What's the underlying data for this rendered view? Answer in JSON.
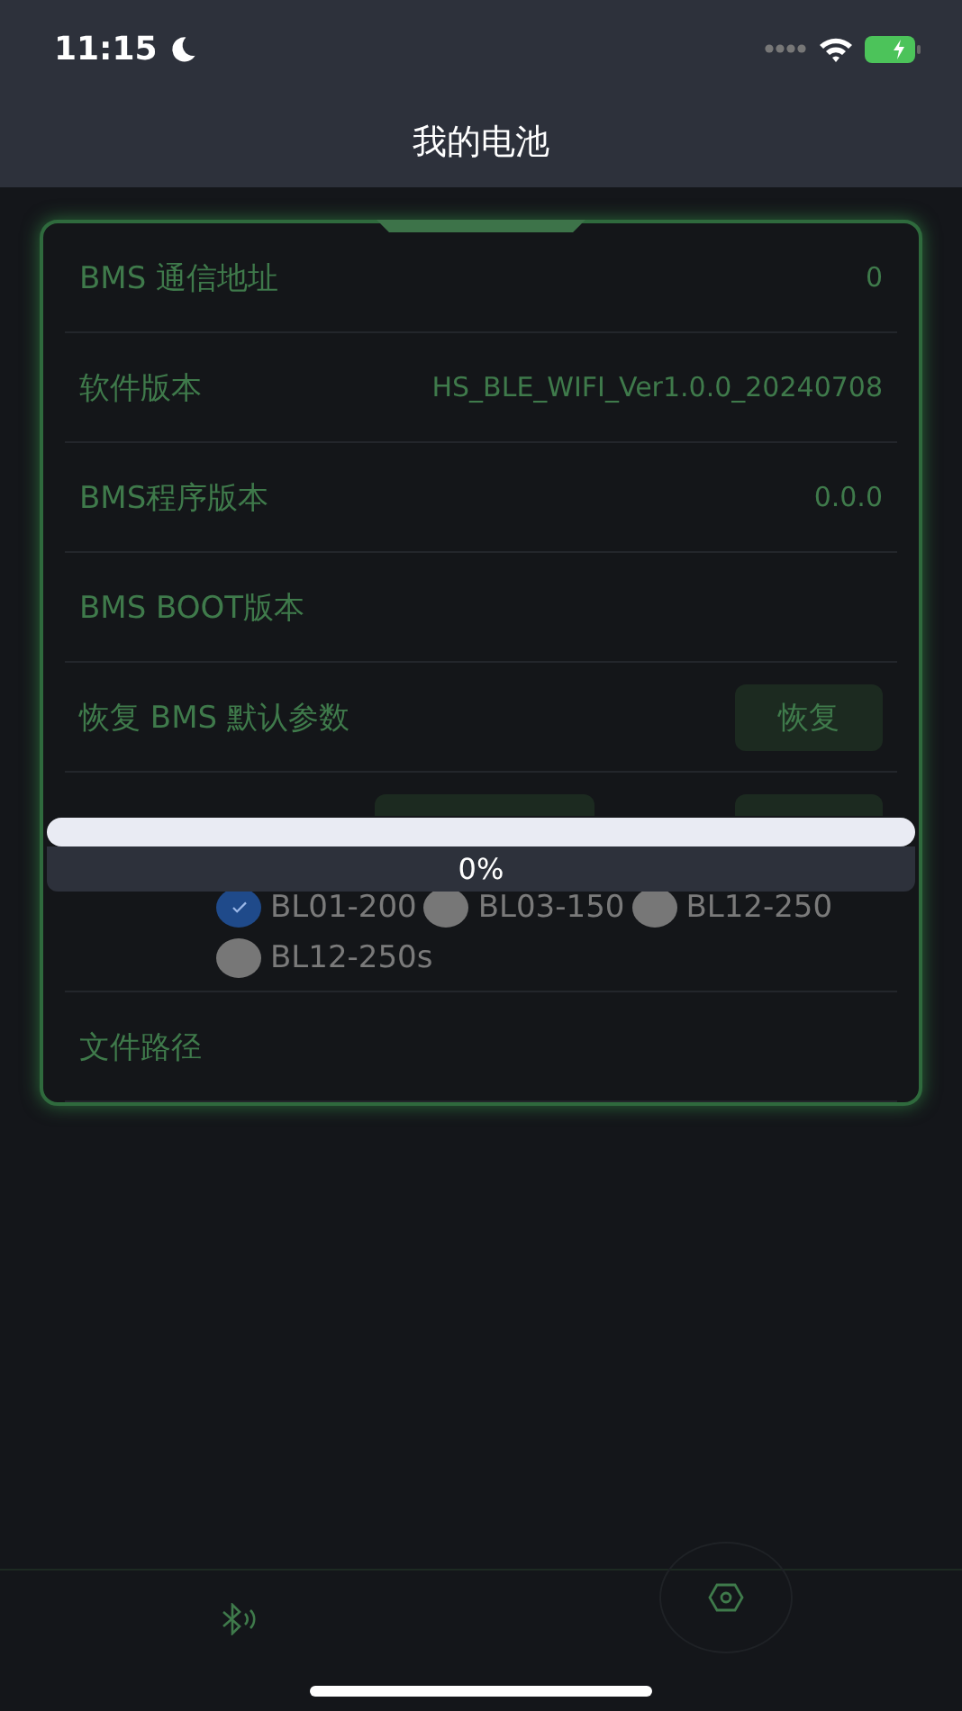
{
  "status_bar": {
    "time": "11:15"
  },
  "header": {
    "title": "我的电池"
  },
  "rows": [
    {
      "kind": "value",
      "label": "BMS 通信地址",
      "value": "0"
    },
    {
      "kind": "value",
      "label": "软件版本",
      "value": "HS_BLE_WIFI_Ver1.0.0_20240708"
    },
    {
      "kind": "value",
      "label": "BMS程序版本",
      "value": "0.0.0"
    },
    {
      "kind": "value",
      "label": "BMS BOOT版本"
    },
    {
      "kind": "button",
      "label": "恢复 BMS 默认参数",
      "button": "恢复"
    },
    {
      "kind": "upgrade"
    },
    {
      "kind": "value",
      "label": "文件路径"
    }
  ],
  "models": [
    {
      "label": "BL01-200",
      "selected": true
    },
    {
      "label": "BL03-150",
      "selected": false
    },
    {
      "label": "BL12-250",
      "selected": false
    },
    {
      "label": "BL12-250s",
      "selected": false
    }
  ],
  "progress": {
    "reading": "0%"
  }
}
